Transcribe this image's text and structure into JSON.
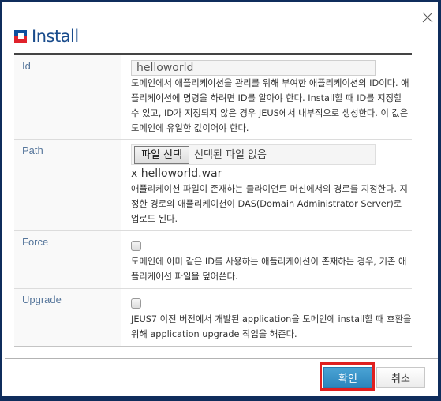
{
  "dialog": {
    "title": "Install",
    "close_icon": "close-icon",
    "title_icon": "install-logo-icon"
  },
  "fields": {
    "id": {
      "label": "Id",
      "value": "helloworld",
      "description": "도메인에서 애플리케이션을 관리를 위해 부여한 애플리케이션의 ID이다. 애플리케이션에 명령을 하려면 ID를 알아야 한다. Install할 때 ID를 지정할 수 있고, ID가 지정되지 않은 경우 JEUS에서 내부적으로 생성한다. 이 값은 도메인에 유일한 값이어야 한다."
    },
    "path": {
      "label": "Path",
      "file_button": "파일 선택",
      "file_status": "선택된 파일 없음",
      "selected_file": "x helloworld.war",
      "description": "애플리케이션 파일이 존재하는 클라이언트 머신에서의 경로를 지정한다. 지정한 경로의 애플리케이션이 DAS(Domain Administrator Server)로 업로드 된다."
    },
    "force": {
      "label": "Force",
      "checked": false,
      "description": "도메인에 이미 같은 ID를 사용하는 애플리케이션이 존재하는 경우, 기존 애플리케이션 파일을 덮어쓴다."
    },
    "upgrade": {
      "label": "Upgrade",
      "checked": false,
      "description": "JEUS7 이전 버전에서 개발된 application을 도메인에 install할 때 호환을 위해 application upgrade 작업을 해준다."
    }
  },
  "footer": {
    "ok_label": "확인",
    "cancel_label": "취소"
  },
  "colors": {
    "frame": "#0f2d5c",
    "title": "#1a4c8c",
    "label": "#56769b",
    "ok_button": "#2d86bd",
    "highlight": "#e02020"
  }
}
